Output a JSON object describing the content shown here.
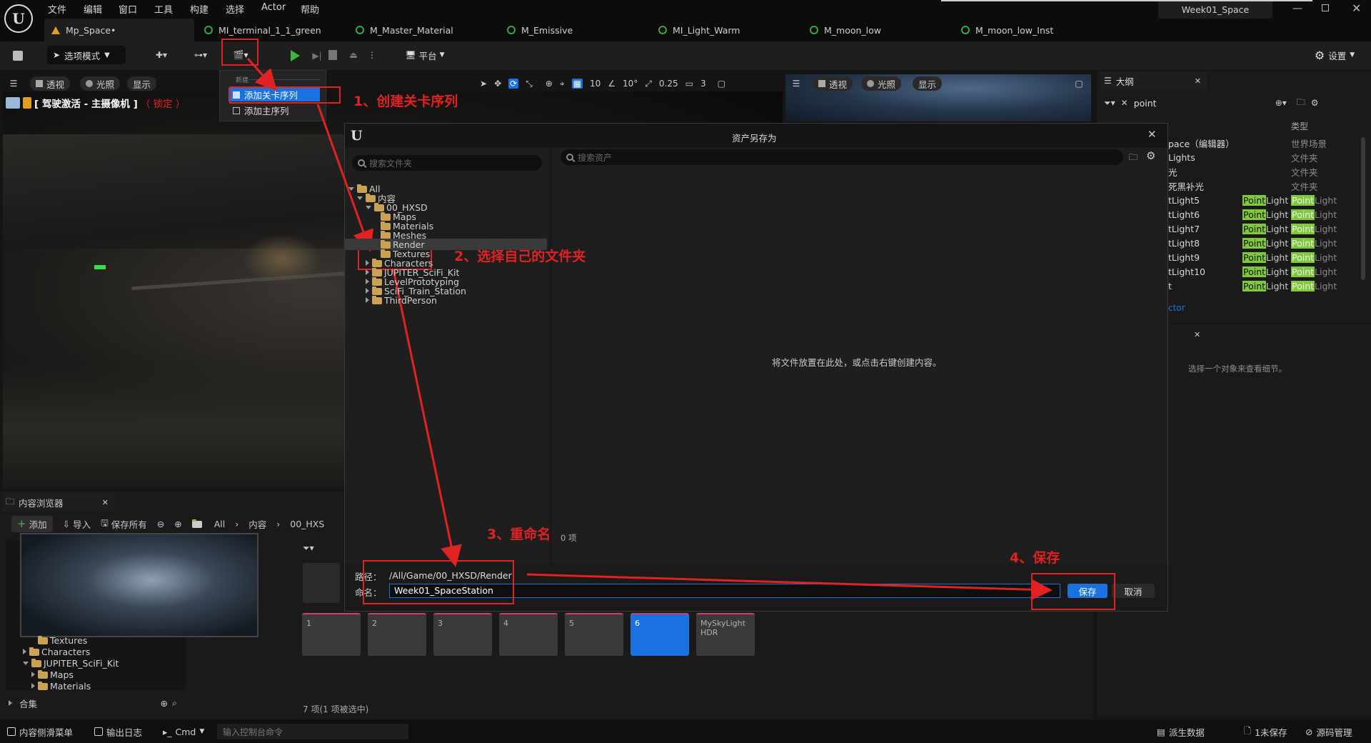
{
  "menubar": {
    "items": [
      "文件",
      "编辑",
      "窗口",
      "工具",
      "构建",
      "选择",
      "Actor",
      "帮助"
    ],
    "project_title": "Week01_Space"
  },
  "tabs": [
    "Mp_Space•",
    "MI_terminal_1_1_green",
    "M_Master_Material",
    "M_Emissive",
    "MI_Light_Warm",
    "M_moon_low",
    "M_moon_low_Inst"
  ],
  "toolbar": {
    "mode": "选项模式",
    "platform": "平台",
    "settings": "设置"
  },
  "dropdown": {
    "header": "新建",
    "item1": "添加关卡序列",
    "item2": "添加主序列"
  },
  "viewport": {
    "perspective": "透视",
    "lit": "光照",
    "show": "显示",
    "camera_label": "[ 驾驶激活 - 主摄像机 ]",
    "locked": "（ 锁定 ）",
    "grid": "10",
    "angle": "10°",
    "scale": "0.25",
    "cam_speed": "3"
  },
  "viewport2": {
    "perspective": "透视",
    "lit": "光照",
    "show": "显示"
  },
  "outliner": {
    "title": "大纲",
    "search_value": "point",
    "col_type": "类型",
    "rows": [
      {
        "name": "pace（编辑器）",
        "type": "世界场景"
      },
      {
        "name": "Lights",
        "type": "文件夹"
      },
      {
        "name": "光",
        "type": "文件夹"
      },
      {
        "name": "死黑补光",
        "type": "文件夹"
      },
      {
        "name": "tLight5",
        "type": "PointLight"
      },
      {
        "name": "tLight6",
        "type": "PointLight"
      },
      {
        "name": "tLight7",
        "type": "PointLight"
      },
      {
        "name": "tLight8",
        "type": "PointLight"
      },
      {
        "name": "tLight9",
        "type": "PointLight"
      },
      {
        "name": "tLight10",
        "type": "PointLight"
      },
      {
        "name": "t",
        "type": "PointLight"
      }
    ],
    "footer": "ctor"
  },
  "details": {
    "empty_text": "选择一个对象来查看细节。"
  },
  "content_browser": {
    "title": "内容浏览器",
    "add": "添加",
    "import": "导入",
    "save_all": "保存所有",
    "path": [
      "All",
      "内容",
      "00_HXS"
    ],
    "tree": [
      "Textures",
      "Characters",
      "JUPITER_SciFi_Kit",
      "Maps",
      "Materials"
    ],
    "collections": "合集",
    "count": "7 项(1 项被选中)",
    "thumbs": [
      "1",
      "2",
      "3",
      "4",
      "5",
      "6",
      "MySkyLight\nHDR"
    ]
  },
  "dialog": {
    "title": "资产另存为",
    "search_folders_placeholder": "搜索文件夹",
    "search_assets_placeholder": "搜索资产",
    "tree": [
      {
        "label": "All",
        "depth": 0,
        "open": true
      },
      {
        "label": "内容",
        "depth": 1,
        "open": true
      },
      {
        "label": "00_HXSD",
        "depth": 2,
        "open": true
      },
      {
        "label": "Maps",
        "depth": 3
      },
      {
        "label": "Materials",
        "depth": 3
      },
      {
        "label": "Meshes",
        "depth": 3
      },
      {
        "label": "Render",
        "depth": 3,
        "selected": true
      },
      {
        "label": "Textures",
        "depth": 3
      },
      {
        "label": "Characters",
        "depth": 2,
        "closed": true
      },
      {
        "label": "JUPITER_SciFi_Kit",
        "depth": 2,
        "closed": true
      },
      {
        "label": "LevelPrototyping",
        "depth": 2,
        "closed": true
      },
      {
        "label": "SciFi_Train_Station",
        "depth": 2,
        "closed": true
      },
      {
        "label": "ThirdPerson",
        "depth": 2,
        "closed": true
      }
    ],
    "empty_hint": "将文件放置在此处，或点击右键创建内容。",
    "item_count": "0 项",
    "path_label": "路径：",
    "path_value": "/All/Game/00_HXSD/Render",
    "name_label": "命名：",
    "name_value": "Week01_SpaceStation",
    "save": "保存",
    "cancel": "取消"
  },
  "annotations": {
    "step1": "1、创建关卡序列",
    "step2": "2、选择自己的文件夹",
    "step3": "3、重命名",
    "step4": "4、保存"
  },
  "statusbar": {
    "drawer": "内容侧滑菜单",
    "output_log": "输出日志",
    "cmd": "Cmd",
    "console_placeholder": "输入控制台命令",
    "derived_data": "派生数据",
    "unsaved": "1未保存",
    "source_control": "源码管理"
  },
  "colors": {
    "accent_blue": "#1a72e0",
    "annotation_red": "#e02222",
    "pointlight_green": "#7fc93a",
    "folder": "#c9a253"
  }
}
